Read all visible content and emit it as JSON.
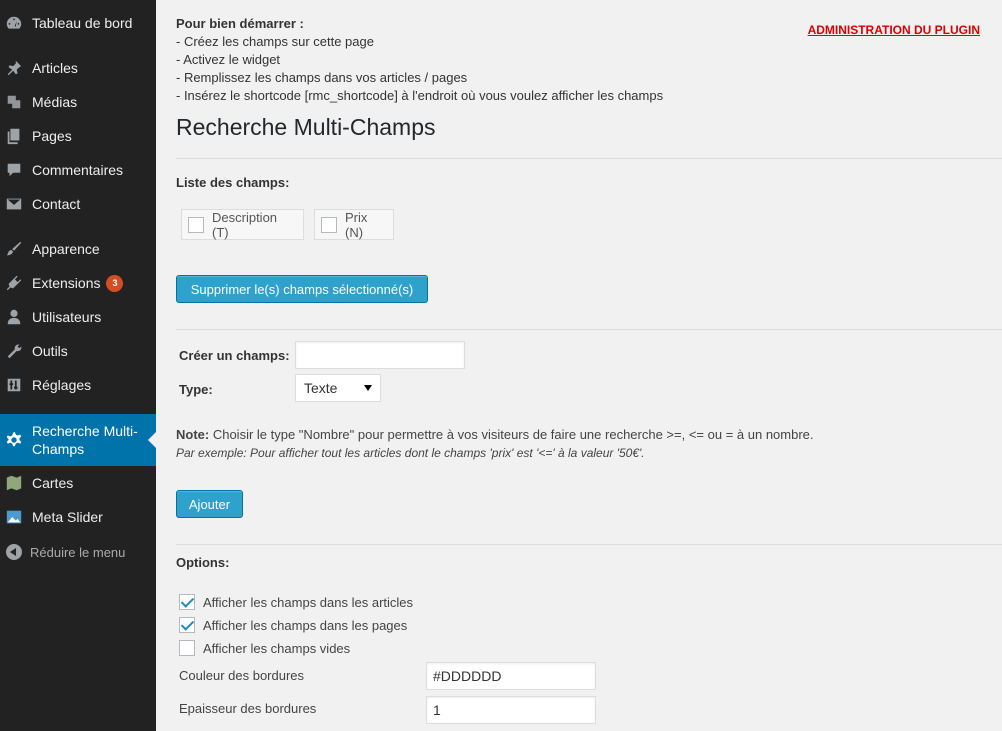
{
  "sidebar": {
    "items": [
      {
        "label": "Tableau de bord",
        "icon": "dashboard-icon"
      },
      {
        "label": "Articles",
        "icon": "pin-icon"
      },
      {
        "label": "Médias",
        "icon": "media-icon"
      },
      {
        "label": "Pages",
        "icon": "pages-icon"
      },
      {
        "label": "Commentaires",
        "icon": "comments-icon"
      },
      {
        "label": "Contact",
        "icon": "mail-icon"
      },
      {
        "label": "Apparence",
        "icon": "brush-icon"
      },
      {
        "label": "Extensions",
        "icon": "plugin-icon",
        "badge": "3"
      },
      {
        "label": "Utilisateurs",
        "icon": "user-icon"
      },
      {
        "label": "Outils",
        "icon": "wrench-icon"
      },
      {
        "label": "Réglages",
        "icon": "settings-sliders-icon"
      },
      {
        "label": "Recherche Multi-Champs",
        "icon": "gear-icon",
        "active": true
      },
      {
        "label": "Cartes",
        "icon": "map-icon"
      },
      {
        "label": "Meta Slider",
        "icon": "slider-icon"
      }
    ],
    "collapse_label": "Réduire le menu"
  },
  "intro": {
    "heading": "Pour bien démarrer :",
    "steps": [
      "- Créez les champs sur cette page",
      "- Activez le widget",
      "- Remplissez les champs dans vos articles / pages",
      "- Insérez le shortcode [rmc_shortcode] à l'endroit où vous voulez afficher les champs"
    ]
  },
  "admin_link": "ADMINISTRATION DU PLUGIN",
  "page_title": "Recherche Multi-Champs",
  "fields_section": {
    "label": "Liste des champs:",
    "fields": [
      "Description (T)",
      "Prix (N)"
    ],
    "delete_button": "Supprimer le(s) champs sélectionné(s)"
  },
  "create_section": {
    "name_label": "Créer un champs:",
    "name_value": "",
    "type_label": "Type:",
    "type_value": "Texte",
    "note_strong": "Note:",
    "note_text": " Choisir le type \"Nombre\" pour permettre à vos visiteurs de faire une recherche >=, <= ou = à un nombre.",
    "note_example": "Par exemple: Pour afficher tout les articles dont le champs 'prix' est '<=' à la valeur '50€'.",
    "add_button": "Ajouter"
  },
  "options": {
    "label": "Options:",
    "checkboxes": [
      {
        "label": "Afficher les champs dans les articles",
        "checked": true
      },
      {
        "label": "Afficher les champs dans les pages",
        "checked": true
      },
      {
        "label": "Afficher les champs vides",
        "checked": false
      }
    ],
    "border_color_label": "Couleur des bordures",
    "border_color_value": "#DDDDDD",
    "border_width_label": "Epaisseur des bordures",
    "border_width_value": "1"
  }
}
